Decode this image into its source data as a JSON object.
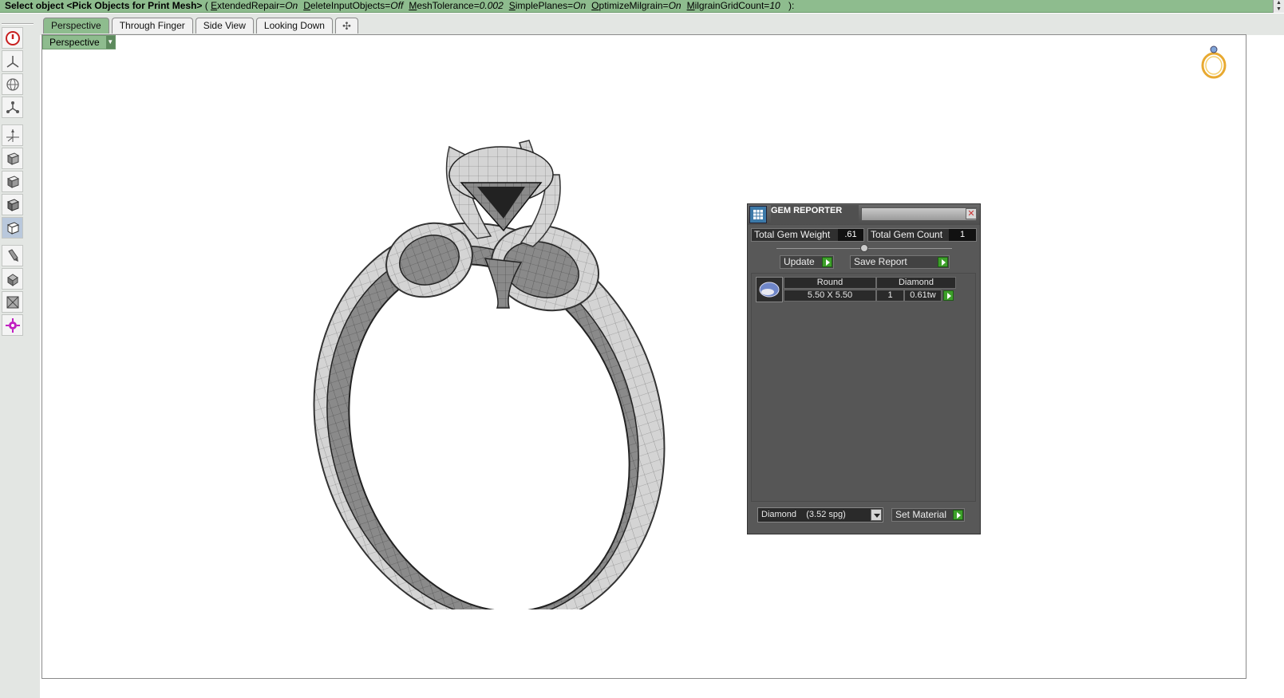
{
  "command": {
    "prompt": "Select object <Pick Objects for Print Mesh>",
    "open": " ( ",
    "close": " ):",
    "options": [
      {
        "key_u": "E",
        "key_rest": "xtendedRepair",
        "value": "On"
      },
      {
        "key_u": "D",
        "key_rest": "eleteInputObjects",
        "value": "Off"
      },
      {
        "key_u": "M",
        "key_rest": "eshTolerance",
        "value": "0.002"
      },
      {
        "key_u": "S",
        "key_rest": "implePlanes",
        "value": "On"
      },
      {
        "key_u": "O",
        "key_rest": "ptimizeMilgrain",
        "value": "On"
      },
      {
        "key_u": "M",
        "key_rest": "ilgrainGridCount",
        "value": "10"
      }
    ]
  },
  "tabs": [
    {
      "label": "Perspective",
      "active": true
    },
    {
      "label": "Through Finger",
      "active": false
    },
    {
      "label": "Side View",
      "active": false
    },
    {
      "label": "Looking Down",
      "active": false
    },
    {
      "label": "✣",
      "active": false
    }
  ],
  "viewport": {
    "label": "Perspective"
  },
  "toolbar": [
    {
      "icon": "power-icon"
    },
    {
      "icon": "axes-icon"
    },
    {
      "icon": "globe-icon"
    },
    {
      "icon": "network-icon"
    },
    {
      "icon": "gumball-icon"
    },
    {
      "icon": "cube-shaded-icon"
    },
    {
      "icon": "cube-rendered-icon"
    },
    {
      "icon": "cube-wire-icon"
    },
    {
      "icon": "cube-selected-icon"
    },
    {
      "icon": "brush-icon"
    },
    {
      "icon": "paint-icon"
    },
    {
      "icon": "image-icon"
    },
    {
      "icon": "gear-icon"
    }
  ],
  "gem_reporter": {
    "title": "GEM REPORTER",
    "total_weight_label": "Total Gem Weight",
    "total_weight_value": ".61",
    "total_count_label": "Total Gem Count",
    "total_count_value": "1",
    "update_label": "Update",
    "save_label": "Save Report",
    "gem": {
      "shape": "Round",
      "material": "Diamond",
      "size": "5.50 X 5.50",
      "qty": "1",
      "weight": "0.61tw"
    },
    "material_select": "Diamond    (3.52 spg)",
    "set_material_label": "Set Material"
  },
  "colors": {
    "accent_green": "#8ebc8e",
    "go_green": "#3da02a",
    "panel_bg": "#585858"
  }
}
